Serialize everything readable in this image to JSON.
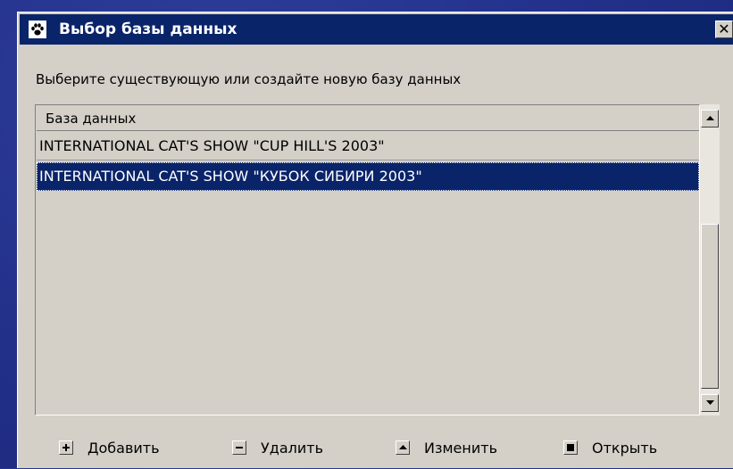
{
  "window": {
    "title": "Выбор базы данных",
    "close_glyph": "✕"
  },
  "prompt": "Выберите существующую или создайте новую базу данных",
  "list": {
    "header": "База данных",
    "items": [
      "INTERNATIONAL CAT'S SHOW \"CUP HILL'S 2003\"",
      "INTERNATIONAL CAT'S SHOW \"КУБОК СИБИРИ 2003\""
    ],
    "selected_index": 1
  },
  "buttons": {
    "add": "Добавить",
    "delete": "Удалить",
    "edit": "Изменить",
    "open": "Открыть"
  },
  "icons": {
    "app": "paw-icon",
    "add": "plus-icon",
    "delete": "minus-icon",
    "edit": "triangle-up-icon",
    "open": "square-icon"
  },
  "colors": {
    "titlebar": "#0a246a",
    "selection": "#0a246a",
    "window_face": "#d4d0c8",
    "desktop": "#22308a"
  }
}
